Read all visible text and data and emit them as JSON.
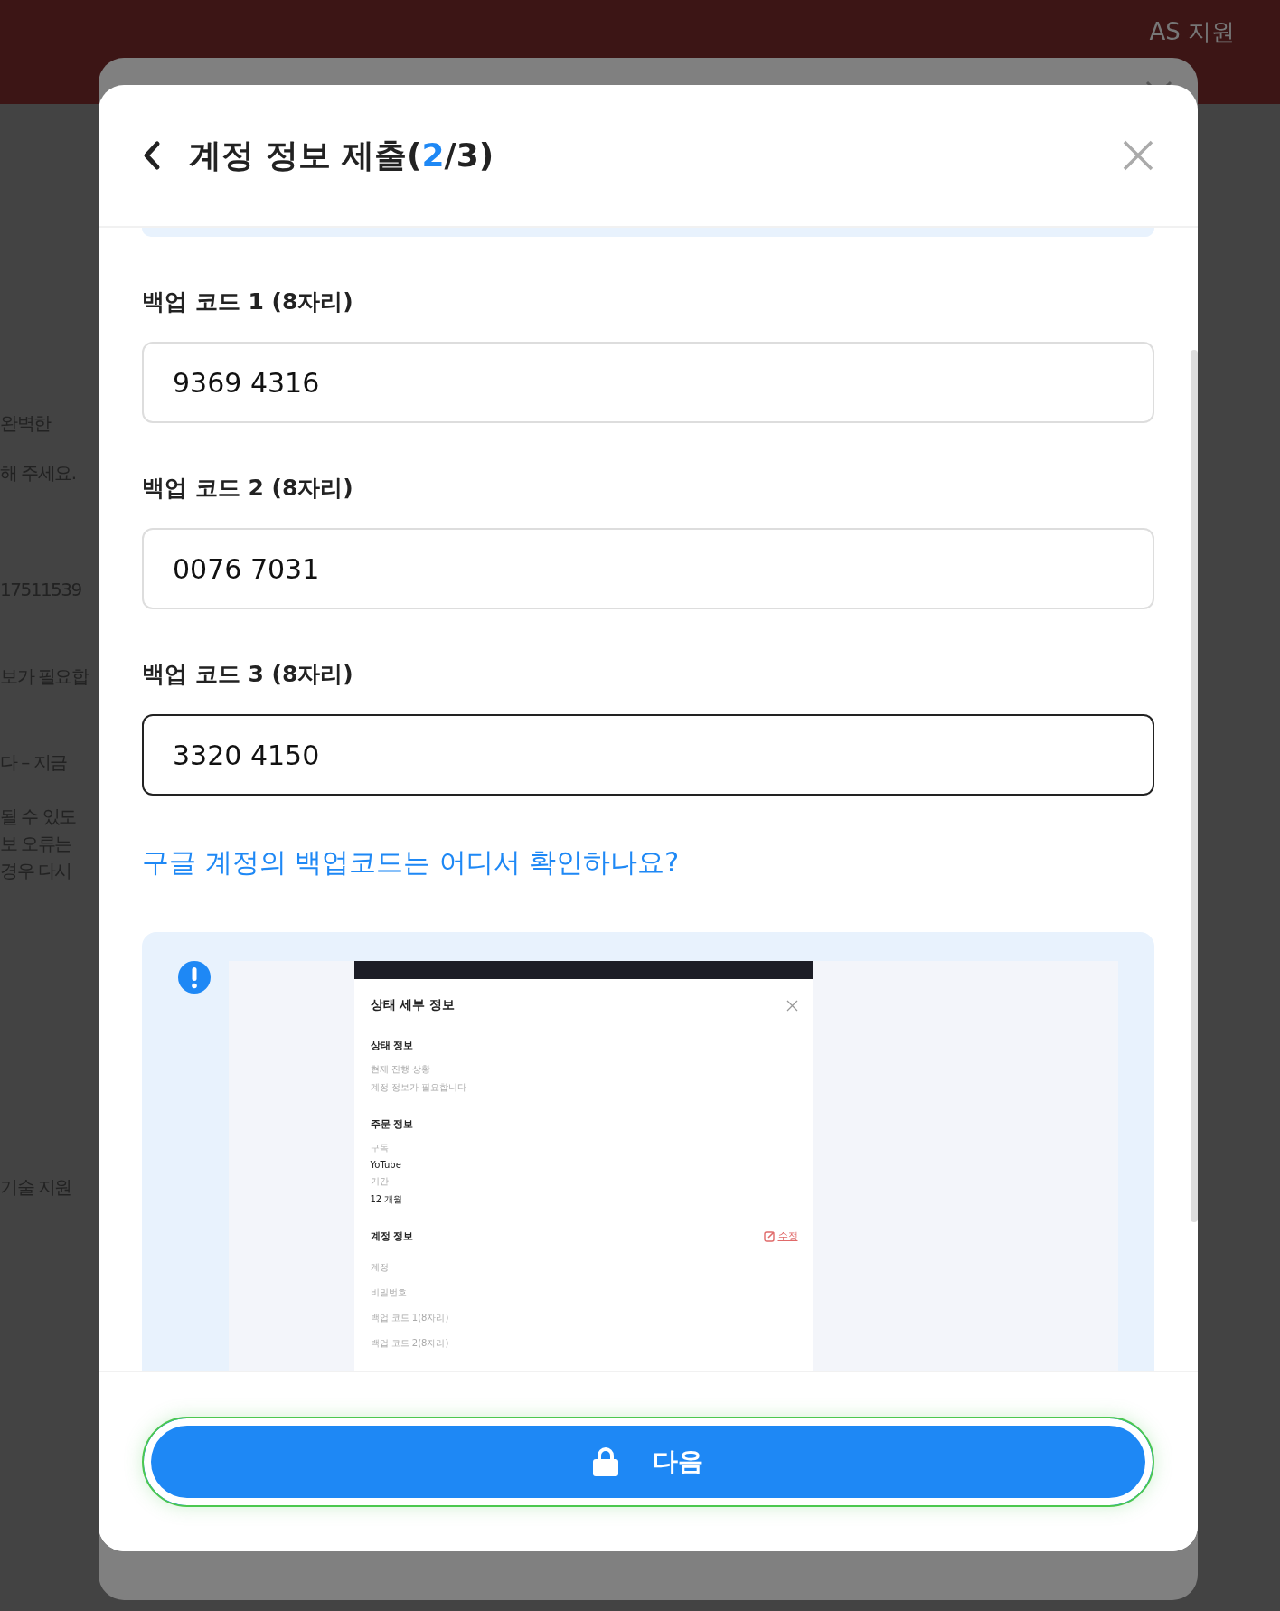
{
  "page": {
    "nav": [
      {
        "label": "AS 지원"
      }
    ],
    "background_texts": [
      "완벽한",
      "해 주세요.",
      "17511539",
      "보가 필요합",
      "다 – 지금",
      "될 수 있도",
      "보 오류는",
      "경우 다시",
      "기술 지원"
    ]
  },
  "modal": {
    "title": "계정 정보 제출(",
    "step_current": "2",
    "step_rest": "/3)",
    "fields": [
      {
        "label": "백업 코드 1 (8자리)",
        "value": "9369 4316",
        "focused": false
      },
      {
        "label": "백업 코드 2 (8자리)",
        "value": "0076 7031",
        "focused": false
      },
      {
        "label": "백업 코드 3 (8자리)",
        "value": "3320 4150",
        "focused": true
      }
    ],
    "help_link": "구글 계정의 백업코드는 어디서 확인하나요?",
    "example": {
      "title": "상태 세부 정보",
      "edit": "수정",
      "sections": [
        {
          "heading": "상태 정보",
          "items": [
            {
              "kind": "label",
              "text": "현재 진행 상황"
            },
            {
              "kind": "label",
              "text": "계정 정보가 필요합니다"
            }
          ]
        },
        {
          "heading": "주문 정보",
          "items": [
            {
              "kind": "label",
              "text": "구독"
            },
            {
              "kind": "value",
              "text": "YoTube"
            },
            {
              "kind": "label",
              "text": "기간"
            },
            {
              "kind": "value",
              "text": "12 개월"
            }
          ]
        },
        {
          "heading": "계정 정보",
          "editable": true,
          "items": [
            {
              "kind": "label",
              "text": "계정"
            },
            {
              "kind": "label",
              "text": "비밀번호"
            },
            {
              "kind": "label",
              "text": "백업 코드 1(8자리)"
            },
            {
              "kind": "label",
              "text": "백업 코드 2(8자리)"
            }
          ]
        }
      ]
    },
    "next_button": "다음"
  }
}
